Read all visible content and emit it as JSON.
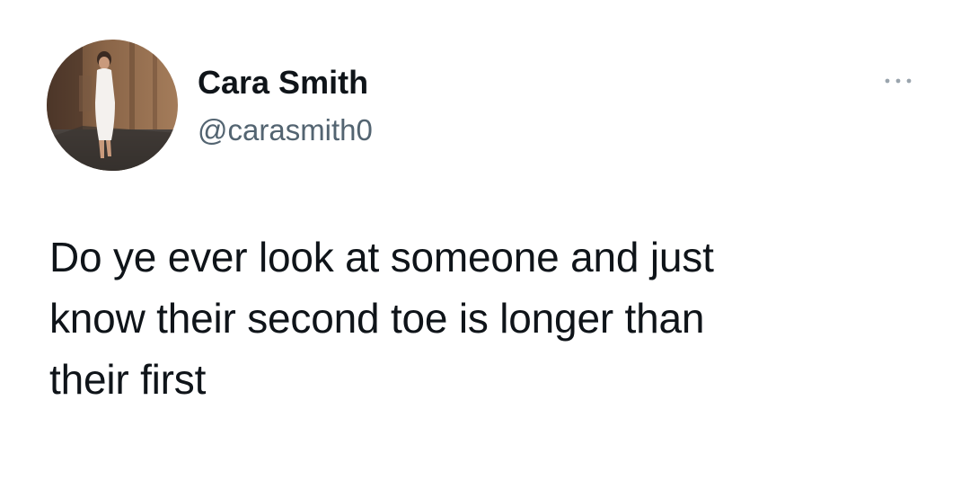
{
  "tweet": {
    "author": {
      "display_name": "Cara Smith",
      "handle": "@carasmith0",
      "avatar_icon": "profile-photo-avatar"
    },
    "more_icon": "ellipsis-icon",
    "text": "Do ye ever look at someone and just\nknow their second toe is longer than\ntheir first"
  },
  "colors": {
    "background": "#ffffff",
    "text": "#0f1419",
    "secondary_text": "#536471",
    "more_icon": "#9aa4ad"
  }
}
